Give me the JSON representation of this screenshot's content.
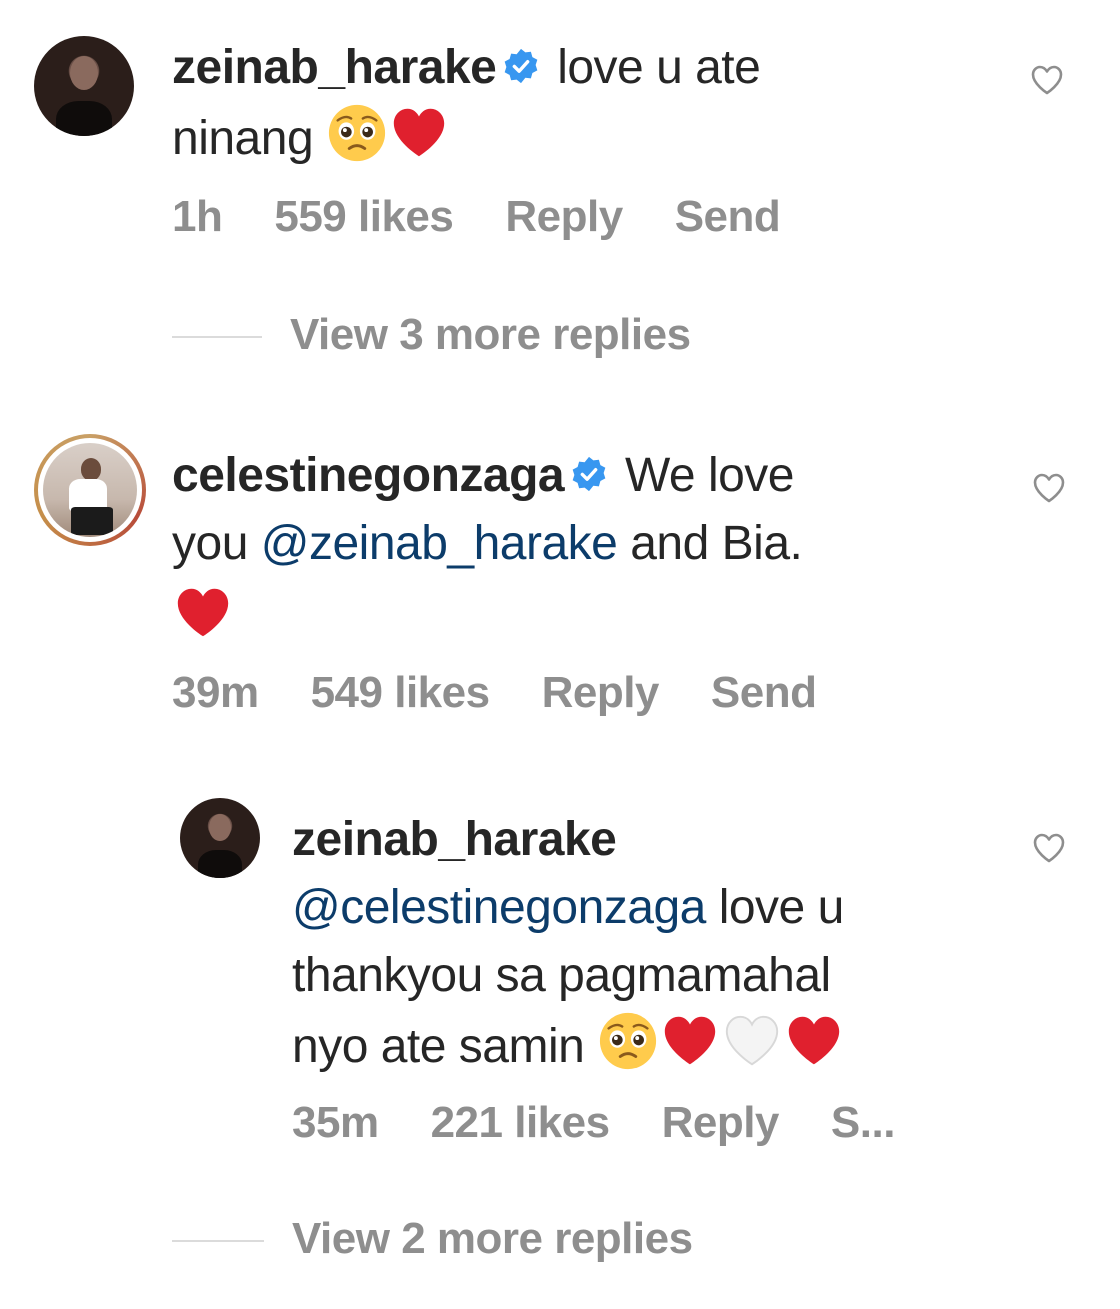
{
  "comments": [
    {
      "username": "zeinab_harake",
      "text_1": "love u ate",
      "text_2": "ninang",
      "time": "1h",
      "likes": "559 likes",
      "reply": "Reply",
      "send": "Send",
      "view_more": "View 3 more replies"
    },
    {
      "username": "celestinegonzaga",
      "text_1": "We love",
      "text_2": "you",
      "mention": "@zeinab_harake",
      "text_3": "and Bia.",
      "time": "39m",
      "likes": "549 likes",
      "reply": "Reply",
      "send": "Send"
    },
    {
      "username": "zeinab_harake",
      "mention": "@celestinegonzaga",
      "text_1": "love u",
      "text_2": "thankyou sa pagmamahal",
      "text_3": "nyo ate samin",
      "time": "35m",
      "likes": "221 likes",
      "reply": "Reply",
      "send": "S...",
      "view_more": "View 2 more replies"
    }
  ],
  "colors": {
    "text": "#262626",
    "meta": "#8e8e8e",
    "mention": "#0c3c6a",
    "verified": "#3897f0",
    "heart": "#e0202e"
  },
  "icons": [
    "verified-badge-icon",
    "pleading-face-emoji",
    "red-heart-emoji",
    "white-heart-emoji",
    "like-heart-icon"
  ]
}
